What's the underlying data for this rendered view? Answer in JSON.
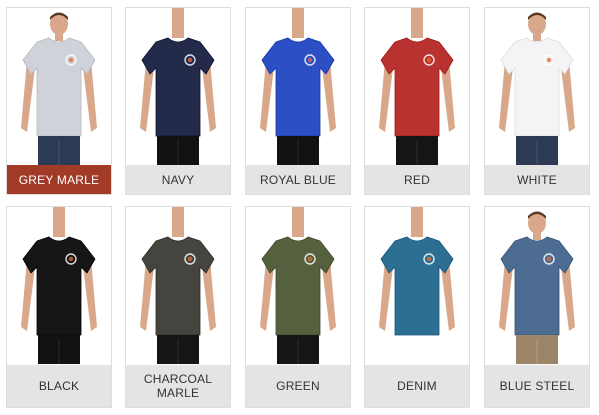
{
  "swatches": [
    {
      "label": "GREY MARLE",
      "color": "#cfd3d9",
      "selected": true,
      "has_head": true,
      "pants": "#2d3a55"
    },
    {
      "label": "NAVY",
      "color": "#232a4a",
      "selected": false,
      "has_head": false,
      "pants": "#111111"
    },
    {
      "label": "ROYAL BLUE",
      "color": "#2d4fc4",
      "selected": false,
      "has_head": false,
      "pants": "#111111"
    },
    {
      "label": "RED",
      "color": "#b8332f",
      "selected": false,
      "has_head": false,
      "pants": "#151515"
    },
    {
      "label": "WHITE",
      "color": "#f4f4f6",
      "selected": false,
      "has_head": true,
      "pants": "#2d3a55"
    },
    {
      "label": "BLACK",
      "color": "#161616",
      "selected": false,
      "has_head": false,
      "pants": "#111111"
    },
    {
      "label": "CHARCOAL MARLE",
      "color": "#45443e",
      "selected": false,
      "has_head": false,
      "pants": "#151515"
    },
    {
      "label": "GREEN",
      "color": "#55603f",
      "selected": false,
      "has_head": false,
      "pants": "#151515"
    },
    {
      "label": "DENIM",
      "color": "#2d6f92",
      "selected": false,
      "has_head": false,
      "pants": null
    },
    {
      "label": "BLUE STEEL",
      "color": "#4d6c92",
      "selected": false,
      "has_head": true,
      "pants": "#9c8467"
    }
  ]
}
